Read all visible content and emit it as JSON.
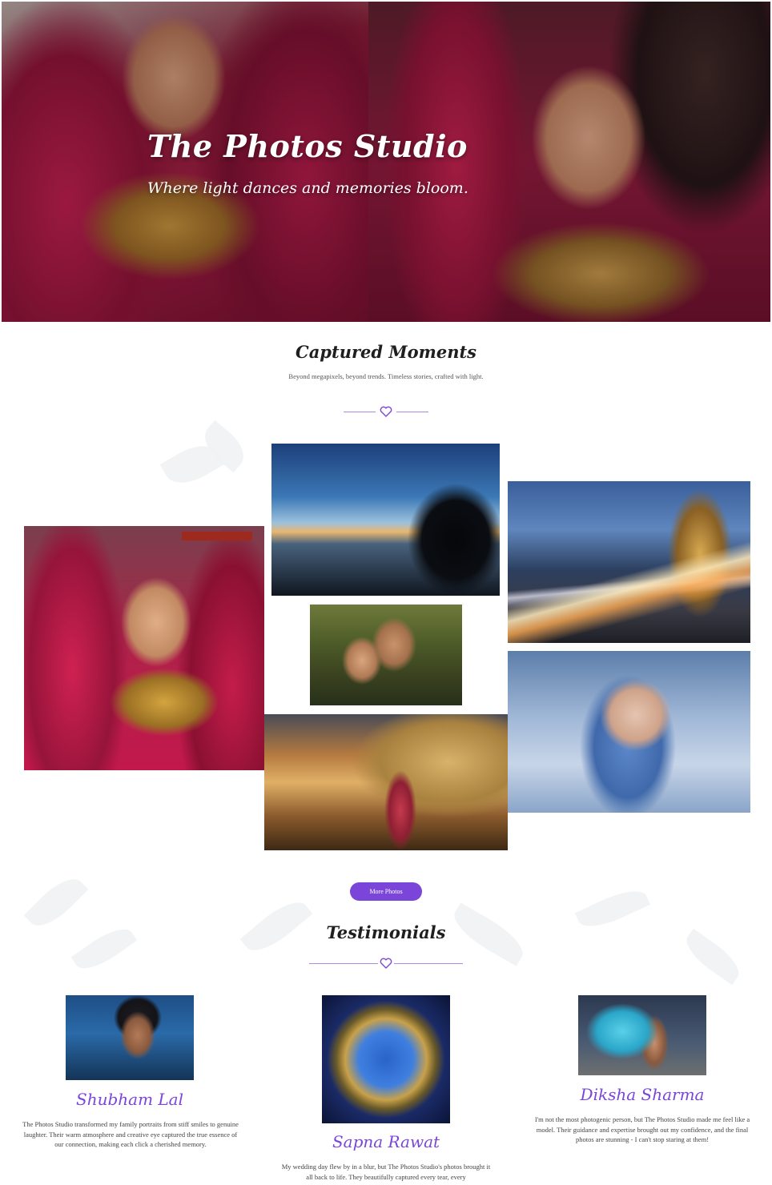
{
  "hero": {
    "title": "The Photos Studio",
    "tagline": "Where light dances and memories bloom."
  },
  "gallery": {
    "title": "Captured Moments",
    "subtitle": "Beyond megapixels, beyond trends. Timeless stories, crafted with light.",
    "more_button": "More Photos"
  },
  "testimonials": {
    "title": "Testimonials",
    "items": [
      {
        "name": "Shubham Lal",
        "text": "The Photos Studio transformed my family portraits from stiff smiles to genuine laughter. Their warm atmosphere and creative eye captured the true essence of our connection, making each click a cherished memory."
      },
      {
        "name": "Sapna Rawat",
        "text": "My wedding day flew by in a blur, but The Photos Studio's photos brought it all back to life. They beautifully captured every tear, every"
      },
      {
        "name": "Diksha Sharma",
        "text": "I'm not the most photogenic person, but The Photos Studio made me feel like a model. Their guidance and expertise brought out my confidence, and the final photos are stunning - I can't stop staring at them!"
      }
    ]
  },
  "colors": {
    "accent": "#7b45d9",
    "divider": "#a98ce0"
  }
}
